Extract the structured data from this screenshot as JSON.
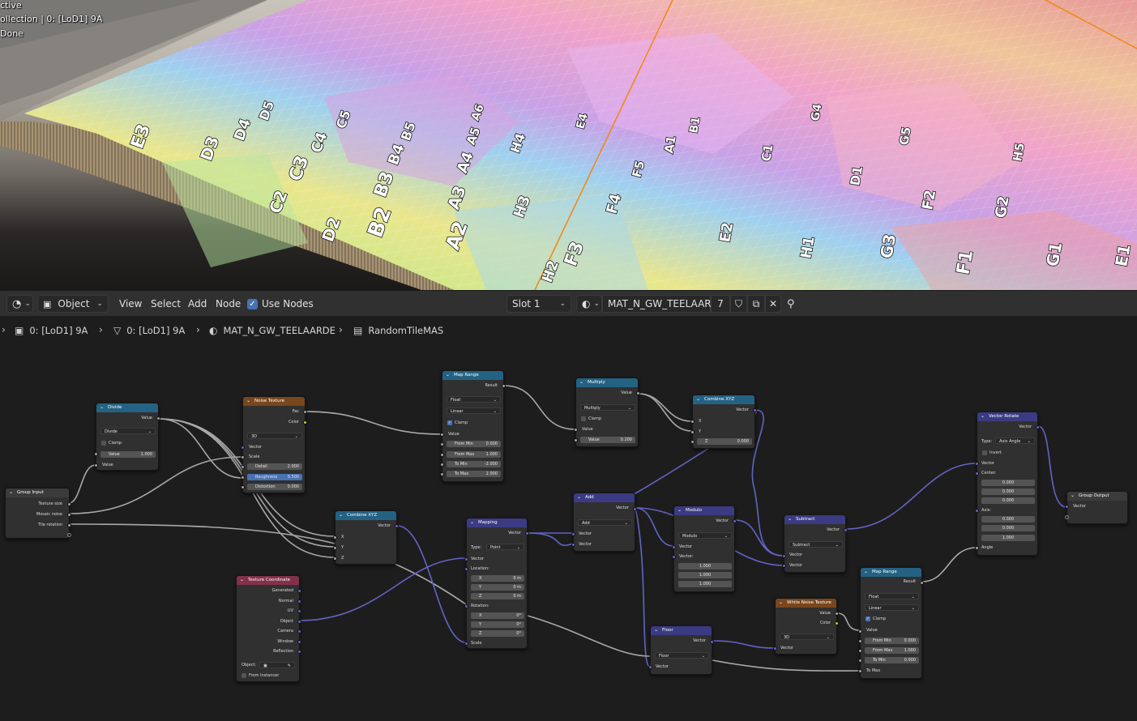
{
  "viewport": {
    "overlay_lines": [
      "ctive",
      "ollection | 0: [LoD1] 9A",
      "Done"
    ],
    "tile_labels": [
      "E3",
      "D3",
      "D4",
      "D5",
      "C3",
      "C4",
      "C5",
      "B2",
      "B3",
      "B4",
      "B5",
      "A2",
      "A3",
      "A4",
      "A5",
      "A6",
      "F3",
      "F4",
      "F5",
      "G1",
      "F1",
      "E1",
      "H1",
      "H2",
      "D2",
      "C2",
      "E2",
      "G3",
      "H3",
      "A1",
      "B1",
      "C1",
      "D1",
      "E4",
      "F2",
      "G2",
      "H4",
      "G4",
      "G5",
      "H5"
    ],
    "colors": {
      "tile_base": "#e8c89a",
      "edge_wood": "#9b8a6c",
      "road": "#7c7a76",
      "orange_line": "#f08a1e"
    }
  },
  "header": {
    "object_mode": "Object",
    "menus": [
      "View",
      "Select",
      "Add",
      "Node"
    ],
    "use_nodes_label": "Use Nodes",
    "use_nodes_checked": true,
    "slot": "Slot 1",
    "material_name": "MAT_N_GW_TEELAARDE",
    "user_count": "7"
  },
  "breadcrumb": {
    "items": [
      "0: [LoD1] 9A",
      "0: [LoD1] 9A",
      "MAT_N_GW_TEELAARDE",
      "RandomTileMAS"
    ]
  },
  "nodes": {
    "group_input": {
      "title": "Group Input",
      "outputs": [
        "Texture size",
        "Mosaic noise",
        "Tile rotation"
      ]
    },
    "divide": {
      "title": "Divide",
      "output": "Value",
      "operation": "Divide",
      "clamp": "Clamp",
      "input1": "Value",
      "value_label": "Value",
      "value": "1.000"
    },
    "noise": {
      "title": "Noise Texture",
      "out1": "Fac",
      "out2": "Color",
      "dim": "3D",
      "vector": "Vector",
      "scale": "Scale",
      "detail_label": "Detail",
      "detail": "2.000",
      "rough_label": "Roughness",
      "rough": "0.500",
      "dist_label": "Distortion",
      "dist": "0.000"
    },
    "maprange1": {
      "title": "Map Range",
      "output": "Result",
      "dtype": "Float",
      "interp": "Linear",
      "clamp": "Clamp",
      "value": "Value",
      "fmin_label": "From Min",
      "fmin": "0.000",
      "fmax_label": "From Max",
      "fmax": "1.000",
      "tmin_label": "To Min",
      "tmin": "-2.000",
      "tmax_label": "To Max",
      "tmax": "2.000"
    },
    "multiply": {
      "title": "Multiply",
      "output": "Value",
      "operation": "Multiply",
      "clamp": "Clamp",
      "input": "Value",
      "val_label": "Value",
      "val": "0.200"
    },
    "combine1": {
      "title": "Combine XYZ",
      "output": "Vector",
      "x": "X",
      "y": "Y",
      "z_label": "Z",
      "z": "0.000"
    },
    "vecrotate": {
      "title": "Vector Rotate",
      "output": "Vector",
      "type_label": "Type:",
      "type": "Axis Angle",
      "invert": "Invert",
      "vector": "Vector",
      "center": "Center:",
      "c": [
        "0.000",
        "0.000",
        "0.000"
      ],
      "axis": "Axis:",
      "a": [
        "0.000",
        "0.000",
        "1.000"
      ],
      "angle": "Angle"
    },
    "group_output": {
      "title": "Group Output",
      "input": "Vector"
    },
    "combine2": {
      "title": "Combine XYZ",
      "output": "Vector",
      "x": "X",
      "y": "Y",
      "z": "Z"
    },
    "mapping": {
      "title": "Mapping",
      "output": "Vector",
      "type_label": "Type:",
      "type": "Point",
      "vector": "Vector",
      "loc": "Location:",
      "loc_v": [
        [
          "X",
          "0 m"
        ],
        [
          "Y",
          "0 m"
        ],
        [
          "Z",
          "0 m"
        ]
      ],
      "rot": "Rotation:",
      "rot_v": [
        [
          "X",
          "0°"
        ],
        [
          "Y",
          "0°"
        ],
        [
          "Z",
          "0°"
        ]
      ],
      "scale": "Scale"
    },
    "add": {
      "title": "Add",
      "output": "Vector",
      "operation": "Add",
      "in1": "Vector",
      "in2": "Vector"
    },
    "modulo": {
      "title": "Modulo",
      "output": "Vector",
      "operation": "Modulo",
      "in1": "Vector",
      "in2": "Vector:",
      "v": [
        "1.000",
        "1.000",
        "1.000"
      ]
    },
    "subtract": {
      "title": "Subtract",
      "output": "Vector",
      "operation": "Subtract",
      "in1": "Vector",
      "in2": "Vector"
    },
    "texcoord": {
      "title": "Texture Coordinate",
      "outputs": [
        "Generated",
        "Normal",
        "UV",
        "Object",
        "Camera",
        "Window",
        "Reflection"
      ],
      "object_label": "Object:",
      "from_instancer": "From Instancer"
    },
    "floor": {
      "title": "Floor",
      "output": "Vector",
      "operation": "Floor",
      "input": "Vector"
    },
    "whitenoise": {
      "title": "White Noise Texture",
      "out1": "Value",
      "out2": "Color",
      "dim": "3D",
      "input": "Vector"
    },
    "maprange2": {
      "title": "Map Range",
      "output": "Result",
      "dtype": "Float",
      "interp": "Linear",
      "clamp": "Clamp",
      "value": "Value",
      "fmin_label": "From Min",
      "fmin": "0.000",
      "fmax_label": "From Max",
      "fmax": "1.000",
      "tmin_label": "To Min",
      "tmin": "0.000",
      "tmax_label": "To Max"
    }
  }
}
